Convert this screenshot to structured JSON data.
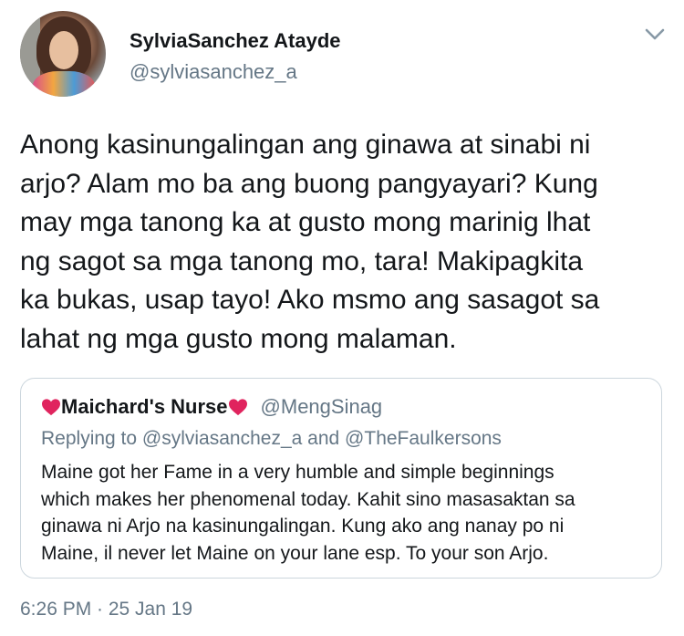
{
  "author": {
    "display_name": "SylviaSanchez Atayde",
    "handle": "@sylviasanchez_a",
    "avatar_icon": "profile-photo"
  },
  "menu_icon": "chevron-down-icon",
  "tweet": {
    "lines": [
      "Anong kasinungalingan ang ginawa at sinabi ni",
      "arjo? Alam mo ba ang buong pangyayari? Kung",
      "may mga tanong ka at gusto mong marinig lhat",
      "ng sagot sa mga tanong mo, tara! Makipagkita",
      "ka bukas, usap tayo! Ako msmo ang sasagot sa",
      "lahat ng mga gusto mong malaman."
    ],
    "timestamp": "6:26 PM · 25 Jan 19"
  },
  "quoted_tweet": {
    "display_name": "Maichard's Nurse",
    "handle": "@MengSinag",
    "replying_prefix": "Replying to",
    "replying_to_1": "@sylviasanchez_a",
    "replying_joiner": "and",
    "replying_to_2": "@TheFaulkersons",
    "lines": [
      "Maine got her Fame in a very humble and simple beginnings",
      "which makes her phenomenal today. Kahit sino masasaktan sa",
      "ginawa ni Arjo na kasinungalingan. Kung ako ang nanay po ni",
      "Maine, il never let Maine on your lane esp. To your son Arjo."
    ],
    "heart_color": "#e0245e"
  },
  "colors": {
    "text": "#14171a",
    "secondary": "#657786",
    "border": "#ccd6dd"
  }
}
